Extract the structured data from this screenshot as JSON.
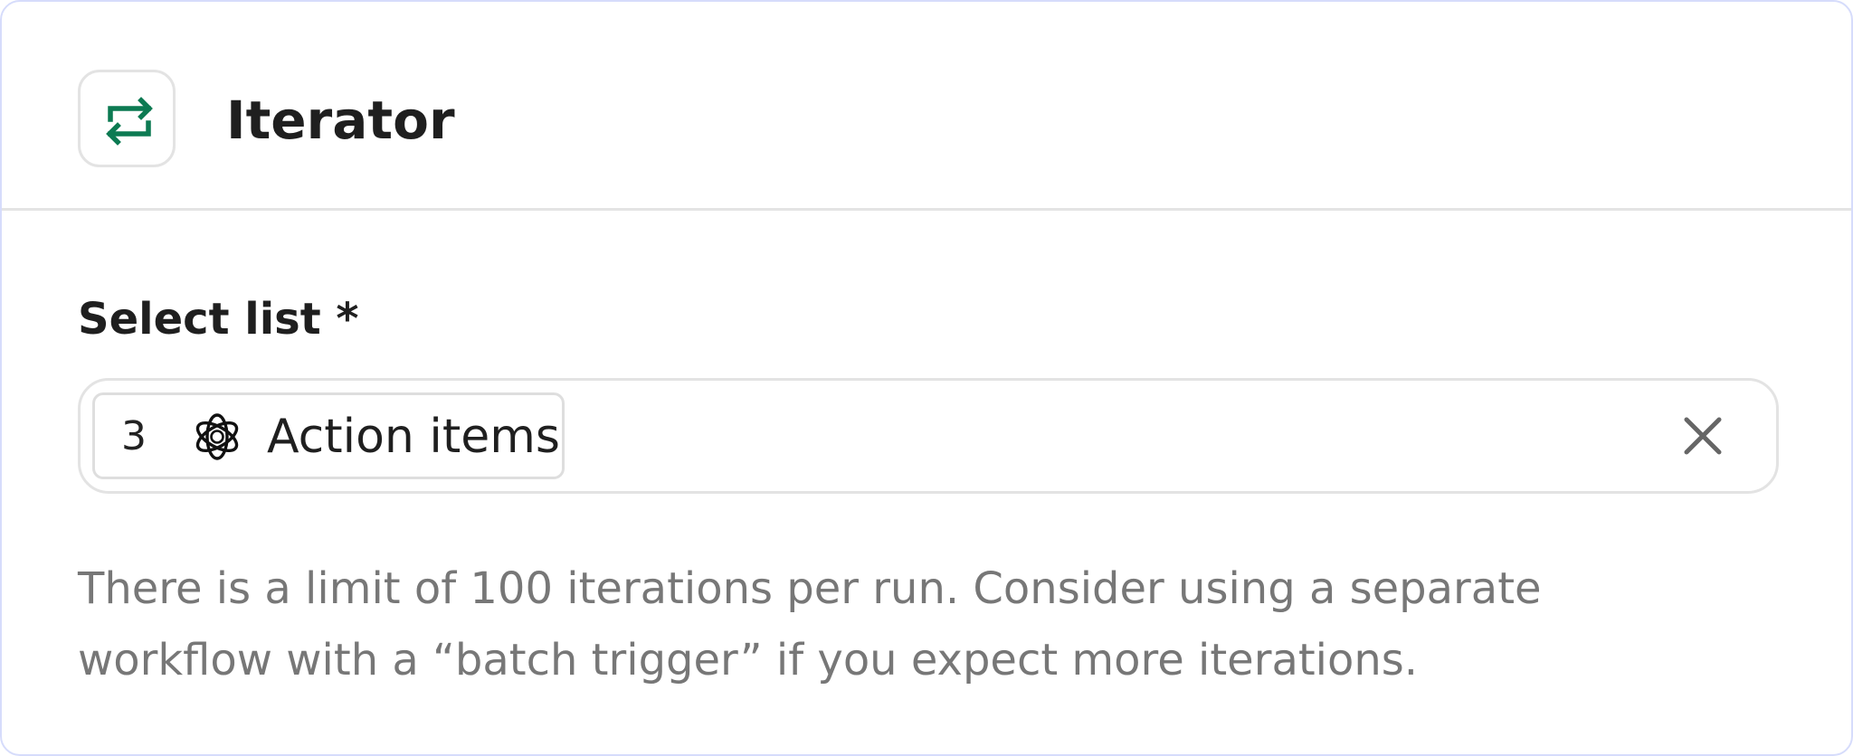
{
  "node": {
    "icon": "repeat-arrows-icon",
    "icon_color": "#0c7a52",
    "title": "Iterator"
  },
  "field": {
    "label": "Select list *",
    "chip": {
      "number": "3",
      "icon": "openai-logo-icon",
      "label": "Action items"
    },
    "clear_icon": "close-icon"
  },
  "help": {
    "text": "There is a limit of 100 iterations per run. Consider using a separate workflow with a “batch trigger” if you expect more iterations."
  },
  "colors": {
    "panel_border": "#d6dcfb",
    "text_primary": "#1f1f1f",
    "text_secondary": "#777777"
  }
}
